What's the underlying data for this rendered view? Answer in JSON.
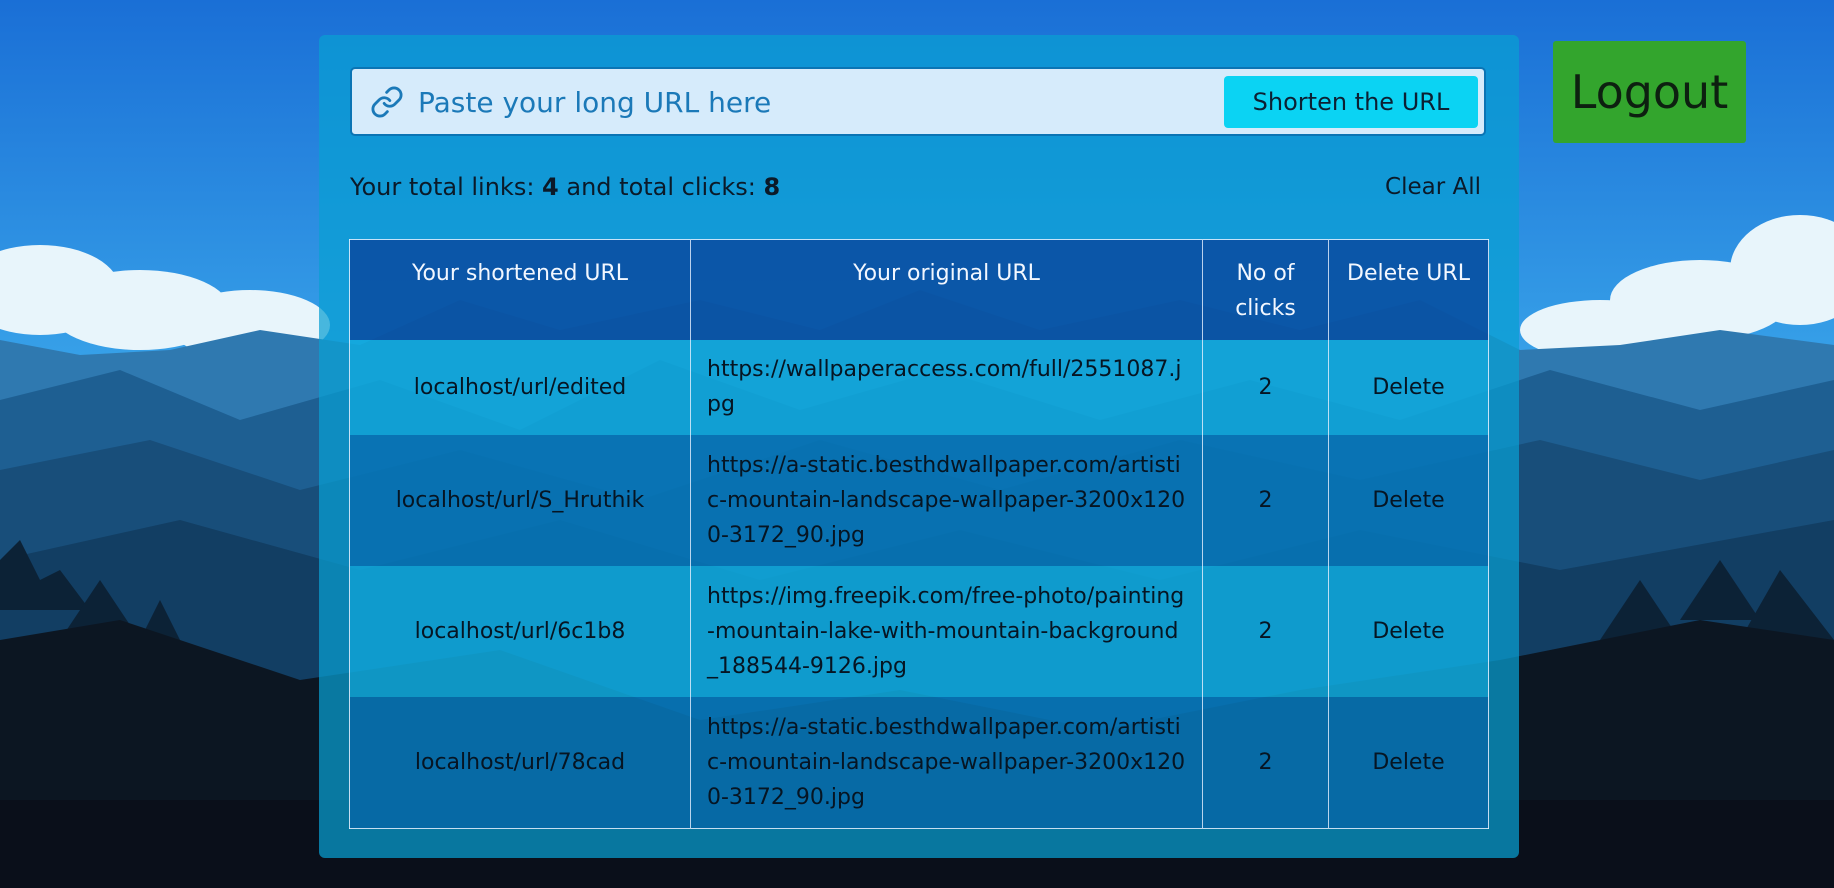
{
  "shortener": {
    "placeholder": "Paste your long URL here",
    "shorten_label": "Shorten the URL"
  },
  "stats": {
    "prefix": "Your total links: ",
    "links": "4",
    "middle": " and total clicks: ",
    "clicks": "8",
    "clear_all_label": "Clear All"
  },
  "table": {
    "headers": [
      "Your shortened URL",
      "Your original URL",
      "No of clicks",
      "Delete URL"
    ],
    "rows": [
      {
        "short": "localhost/url/edited",
        "original": "https://wallpaperaccess.com/full/2551087.jpg",
        "clicks": "2",
        "action": "Delete"
      },
      {
        "short": "localhost/url/S_Hruthik",
        "original": "https://a-static.besthdwallpaper.com/artistic-mountain-landscape-wallpaper-3200x1200-3172_90.jpg",
        "clicks": "2",
        "action": "Delete"
      },
      {
        "short": "localhost/url/6c1b8",
        "original": "https://img.freepik.com/free-photo/painting-mountain-lake-with-mountain-background_188544-9126.jpg",
        "clicks": "2",
        "action": "Delete"
      },
      {
        "short": "localhost/url/78cad",
        "original": "https://a-static.besthdwallpaper.com/artistic-mountain-landscape-wallpaper-3200x1200-3172_90.jpg",
        "clicks": "2",
        "action": "Delete"
      }
    ]
  },
  "logout_label": "Logout",
  "icons": {
    "link": "link-icon"
  },
  "colors": {
    "panel": "#08a0d2",
    "input_bg": "#d6ebfb",
    "shorten_button": "#0bd3f3",
    "logout_button": "#33a52d",
    "header_row": "#083c96"
  }
}
